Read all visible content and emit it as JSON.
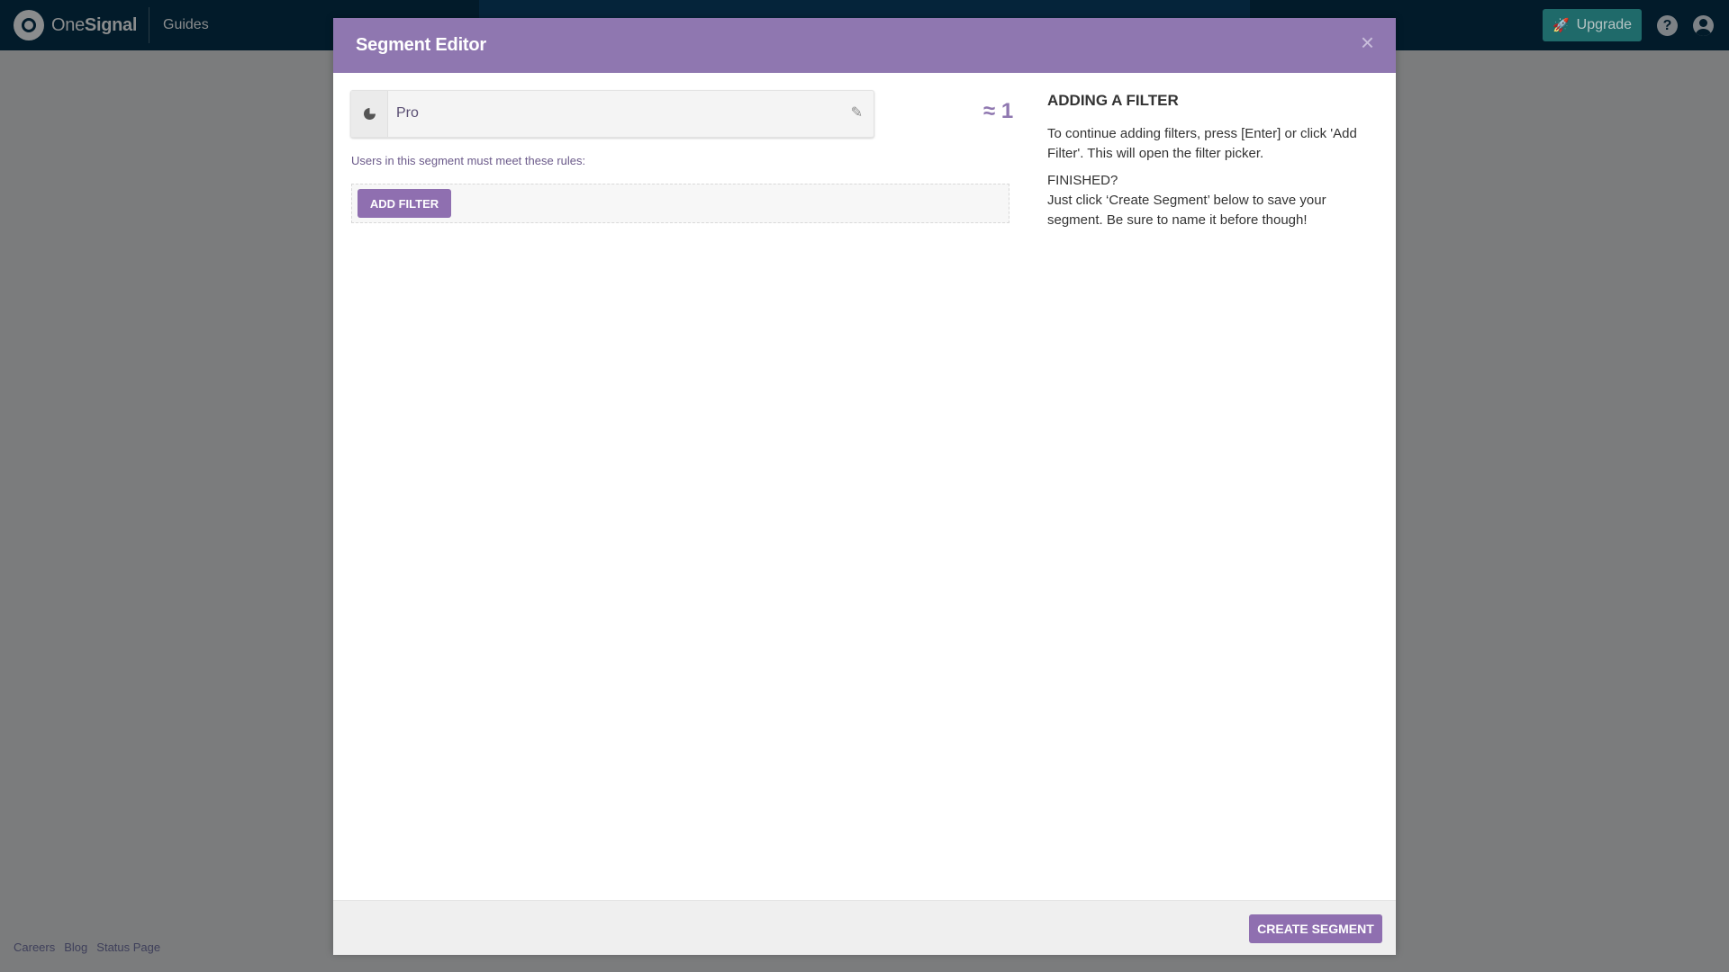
{
  "nav": {
    "brand_one": "One",
    "brand_signal": "Signal",
    "guides_label": "Guides",
    "upgrade_label": "Upgrade",
    "help_glyph": "?"
  },
  "footer": {
    "links": [
      "Careers",
      "Blog",
      "Status Page"
    ]
  },
  "modal": {
    "title": "Segment Editor",
    "close_glyph": "×",
    "segment_name": "Pro",
    "estimate": "≈ 1",
    "rules_label": "Users in this segment must meet these rules:",
    "add_filter_label": "ADD FILTER",
    "help": {
      "title": "ADDING A FILTER",
      "paragraph1": "To continue adding filters, press [Enter] or click 'Add Filter'. This will open the filter picker.",
      "finished_heading": "FINISHED?",
      "paragraph2": "Just click ‘Create Segment’ below to save your segment. Be sure to name it before though!"
    },
    "create_label": "CREATE SEGMENT"
  },
  "icons": {
    "brand": "onesignal-logo-icon",
    "upgrade": "rocket-icon",
    "help": "question-circle-icon",
    "avatar": "user-avatar-icon",
    "segment": "pie-chart-icon",
    "edit": "pencil-icon",
    "close": "close-icon"
  },
  "colors": {
    "header_purple": "#8f77b0",
    "button_purple": "#8f6fb0",
    "nav_bg": "#021b2a",
    "upgrade_teal": "#1f6a6a"
  }
}
